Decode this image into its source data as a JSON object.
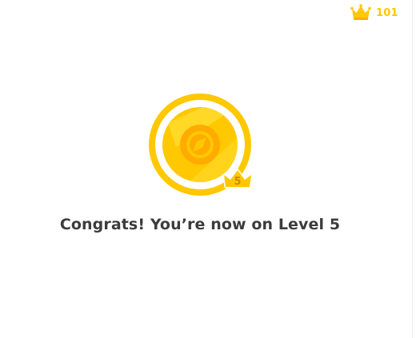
{
  "header": {
    "crown_icon": "crown-icon",
    "crown_count": "101"
  },
  "badge": {
    "icon": "compass-icon",
    "level_number": "5",
    "level_icon": "crown-icon"
  },
  "message": "Congrats! You’re now on Level 5",
  "colors": {
    "gold": "#ffc800",
    "gold_dark": "#ffab00",
    "gold_light": "#ffdf33",
    "text": "#3c3c3c",
    "background": "#ffffff"
  }
}
